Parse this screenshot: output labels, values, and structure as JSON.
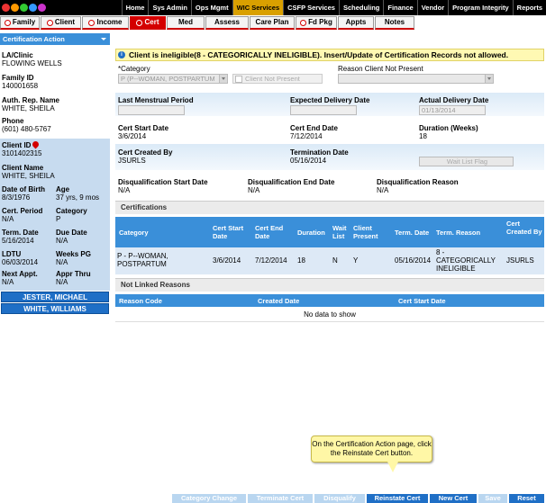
{
  "topnav": [
    "Home",
    "Sys Admin",
    "Ops Mgmt",
    "WIC Services",
    "CSFP Services",
    "Scheduling",
    "Finance",
    "Vendor",
    "Program Integrity",
    "Reports"
  ],
  "active_topnav": "WIC Services",
  "tabs": [
    {
      "label": "Family",
      "icon": true
    },
    {
      "label": "Client",
      "icon": true
    },
    {
      "label": "Income",
      "icon": true
    },
    {
      "label": "Cert",
      "icon": true,
      "active": true
    },
    {
      "label": "Med",
      "icon": false
    },
    {
      "label": "Assess",
      "icon": false
    },
    {
      "label": "Care Plan",
      "icon": false
    },
    {
      "label": "Fd Pkg",
      "icon": true
    },
    {
      "label": "Appts",
      "icon": false
    },
    {
      "label": "Notes",
      "icon": false
    }
  ],
  "sidebar": {
    "action_select": "Certification Action",
    "la_clinic_label": "LA/Clinic",
    "la_clinic": "FLOWING WELLS",
    "family_id_label": "Family ID",
    "family_id": "140001658",
    "auth_rep_label": "Auth. Rep. Name",
    "auth_rep": "WHITE, SHEILA",
    "phone_label": "Phone",
    "phone": "(601) 480-5767",
    "client_id_label": "Client ID",
    "client_id": "3101402315",
    "client_name_label": "Client Name",
    "client_name": "WHITE, SHEILA",
    "dob_label": "Date of Birth",
    "dob": "8/3/1976",
    "age_label": "Age",
    "age": "37 yrs, 9 mos",
    "cert_period_label": "Cert. Period",
    "cert_period": "N/A",
    "category_label": "Category",
    "category": "P",
    "term_date_label": "Term. Date",
    "term_date": "5/16/2014",
    "due_date_label": "Due Date",
    "due_date": "N/A",
    "ldtu_label": "LDTU",
    "ldtu": "06/03/2014",
    "weeks_pg_label": "Weeks PG",
    "weeks_pg": "N/A",
    "next_appt_label": "Next Appt.",
    "next_appt": "N/A",
    "appr_thru_label": "Appr Thru",
    "appr_thru": "N/A",
    "participants": [
      "JESTER, MICHAEL",
      "WHITE, WILLIAMS"
    ]
  },
  "message": "Client is ineligible(8 - CATEGORICALLY INELIGIBLE). Insert/Update of Certification Records not allowed.",
  "form": {
    "category_label": "*Category",
    "category_value": "P (P--WOMAN, POSTPARTUM",
    "client_not_present": "Client Not Present",
    "reason_label": "Reason Client Not Present",
    "lmp_label": "Last Menstrual Period",
    "edd_label": "Expected Delivery Date",
    "add_label": "Actual Delivery Date",
    "add_value": "01/13/2014",
    "cert_start_label": "Cert Start Date",
    "cert_start": "3/6/2014",
    "cert_end_label": "Cert End Date",
    "cert_end": "7/12/2014",
    "duration_label": "Duration (Weeks)",
    "duration": "18",
    "created_by_label": "Cert Created By",
    "created_by": "JSURLS",
    "term_label": "Termination Date",
    "term": "05/16/2014",
    "wait_list": "Wait List Flag",
    "dq_start_label": "Disqualification Start Date",
    "dq_start": "N/A",
    "dq_end_label": "Disqualification End Date",
    "dq_end": "N/A",
    "dq_reason_label": "Disqualification Reason",
    "dq_reason": "N/A"
  },
  "certifications": {
    "title": "Certifications",
    "headers": [
      "Category",
      "Cert Start Date",
      "Cert End Date",
      "Duration",
      "Wait List",
      "Client Present",
      "Term. Date",
      "Term. Reason",
      "Cert Created By"
    ],
    "rows": [
      [
        "P - P--WOMAN, POSTPARTUM",
        "3/6/2014",
        "7/12/2014",
        "18",
        "N",
        "Y",
        "05/16/2014",
        "8 - CATEGORICALLY INELIGIBLE",
        "JSURLS"
      ]
    ]
  },
  "not_linked": {
    "title": "Not Linked Reasons",
    "headers": [
      "Reason Code",
      "Created Date",
      "Cert Start Date"
    ],
    "empty": "No data to show"
  },
  "callout": "On the Certification Action page, click the Reinstate Cert button.",
  "buttons": [
    "Category Change",
    "Terminate Cert",
    "Disqualify",
    "Reinstate Cert",
    "New Cert",
    "Save",
    "Reset"
  ],
  "colors": {
    "accent": "#1f6fc6",
    "tab_active": "#d40000",
    "nav_active": "#d9a000",
    "message_bg": "#fff9b3"
  }
}
